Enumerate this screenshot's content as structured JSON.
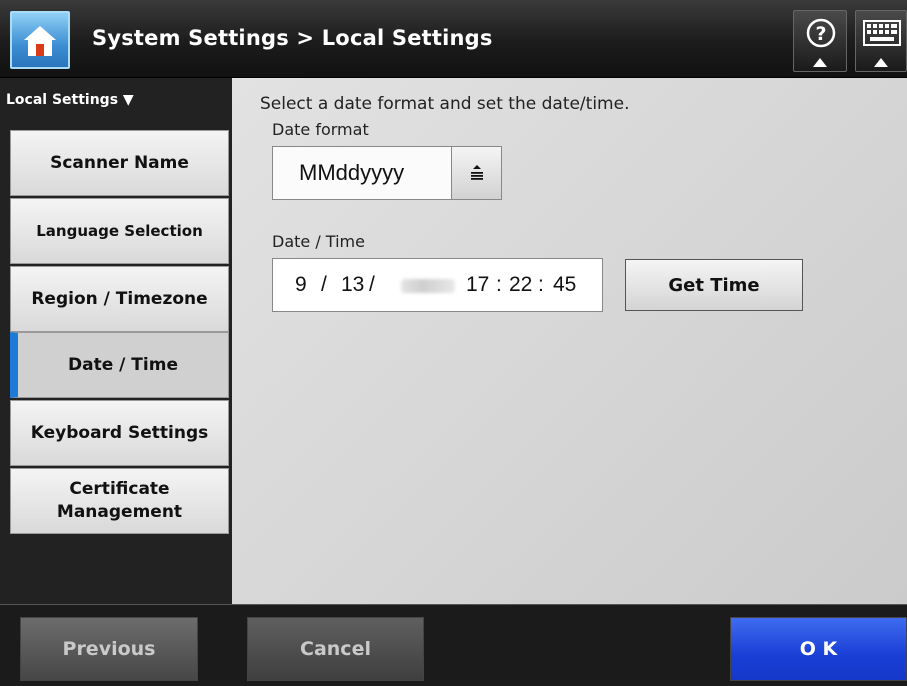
{
  "header": {
    "title": "System Settings > Local Settings",
    "home_icon": "home-icon",
    "help_icon": "help-icon",
    "keyboard_icon": "keyboard-icon"
  },
  "sidebar": {
    "title": "Local Settings ▼",
    "items": [
      {
        "label": "Scanner Name"
      },
      {
        "label": "Language Selection"
      },
      {
        "label": "Region / Timezone"
      },
      {
        "label": "Date / Time"
      },
      {
        "label": "Keyboard Settings"
      },
      {
        "label": "Certificate Management"
      }
    ],
    "active_index": 3
  },
  "main": {
    "instruction": "Select a date format and set the date/time.",
    "date_format_label": "Date format",
    "date_format_value": "MMddyyyy",
    "datetime_label": "Date / Time",
    "month": "9",
    "sep1": "/",
    "day": "13",
    "sep2": "/",
    "hour": "17",
    "colon1": ":",
    "minute": "22",
    "colon2": ":",
    "second": "45",
    "get_time_label": "Get Time"
  },
  "footer": {
    "previous_label": "Previous",
    "cancel_label": "Cancel",
    "ok_label": "O K"
  },
  "colors": {
    "accent": "#1d7ad8",
    "ok_button": "#1a3fd6"
  }
}
